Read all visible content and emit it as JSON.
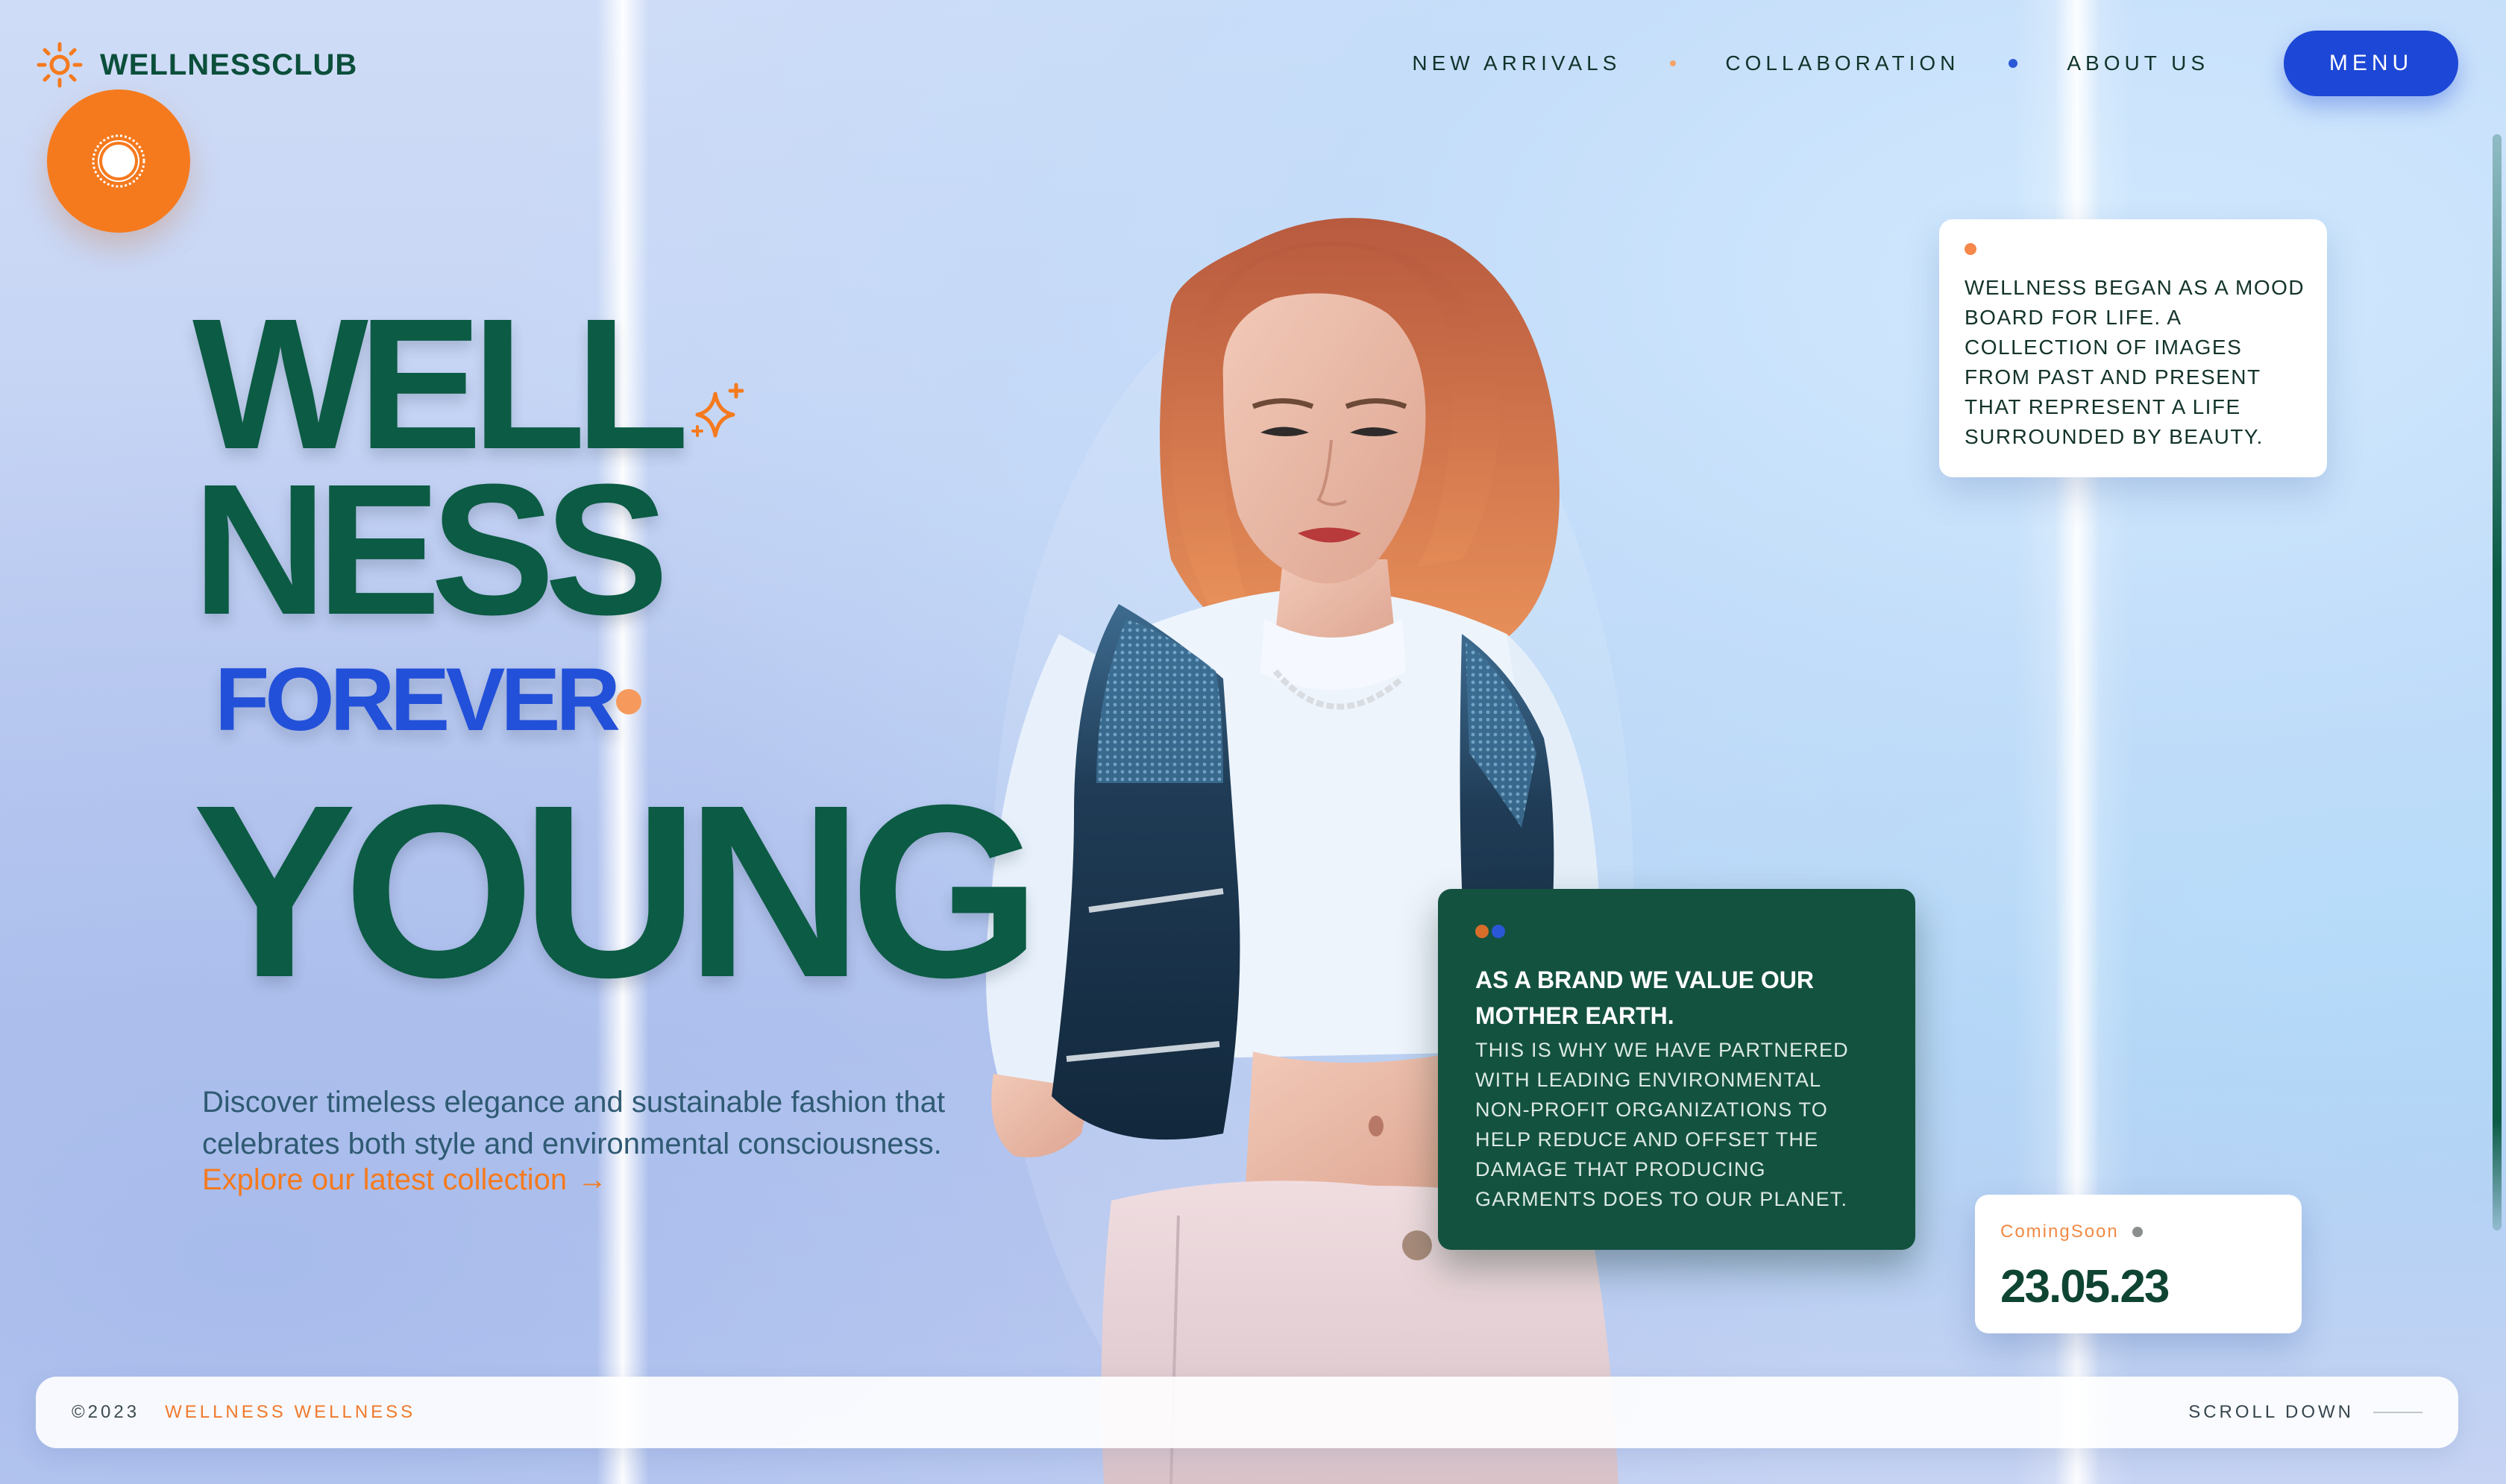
{
  "header": {
    "brand_name": "WELLNESSCLUB",
    "nav": [
      "NEW ARRIVALS",
      "COLLABORATION",
      "ABOUT US"
    ],
    "menu_label": "MENU"
  },
  "hero": {
    "line1": "WELL",
    "line2": "NESS",
    "line3": "FOREVER",
    "line4": "YOUNG",
    "intro": "Discover timeless elegance and sustainable fashion that celebrates both style and environmental consciousness.",
    "cta": "Explore our latest collection",
    "cta_arrow": "→"
  },
  "mood_card": {
    "text": "WELLNESS BEGAN AS A MOOD BOARD FOR LIFE. A COLLECTION OF IMAGES FROM PAST AND PRESENT THAT REPRESENT A LIFE SURROUNDED BY BEAUTY."
  },
  "earth_card": {
    "title": "AS A BRAND WE VALUE OUR MOTHER EARTH.",
    "body": "THIS IS WHY WE HAVE PARTNERED WITH LEADING ENVIRONMENTAL NON-PROFIT ORGANIZATIONS TO HELP REDUCE AND OFFSET THE DAMAGE THAT PRODUCING GARMENTS DOES TO OUR PLANET."
  },
  "soon_card": {
    "label": "ComingSoon",
    "date": "23.05.23"
  },
  "footer": {
    "copyright": "©2023",
    "brand": "WELLNESS WELLNESS",
    "scroll": "SCROLL DOWN"
  },
  "colors": {
    "brand_green": "#0c5b44",
    "accent_blue": "#1d47d6",
    "accent_orange": "#f57a1e",
    "card_green": "#13523f"
  },
  "icons": {
    "brand": "sun-icon",
    "badge": "sun-seal-icon",
    "sparkle": "sparkle-icon",
    "cta": "arrow-right-icon"
  }
}
